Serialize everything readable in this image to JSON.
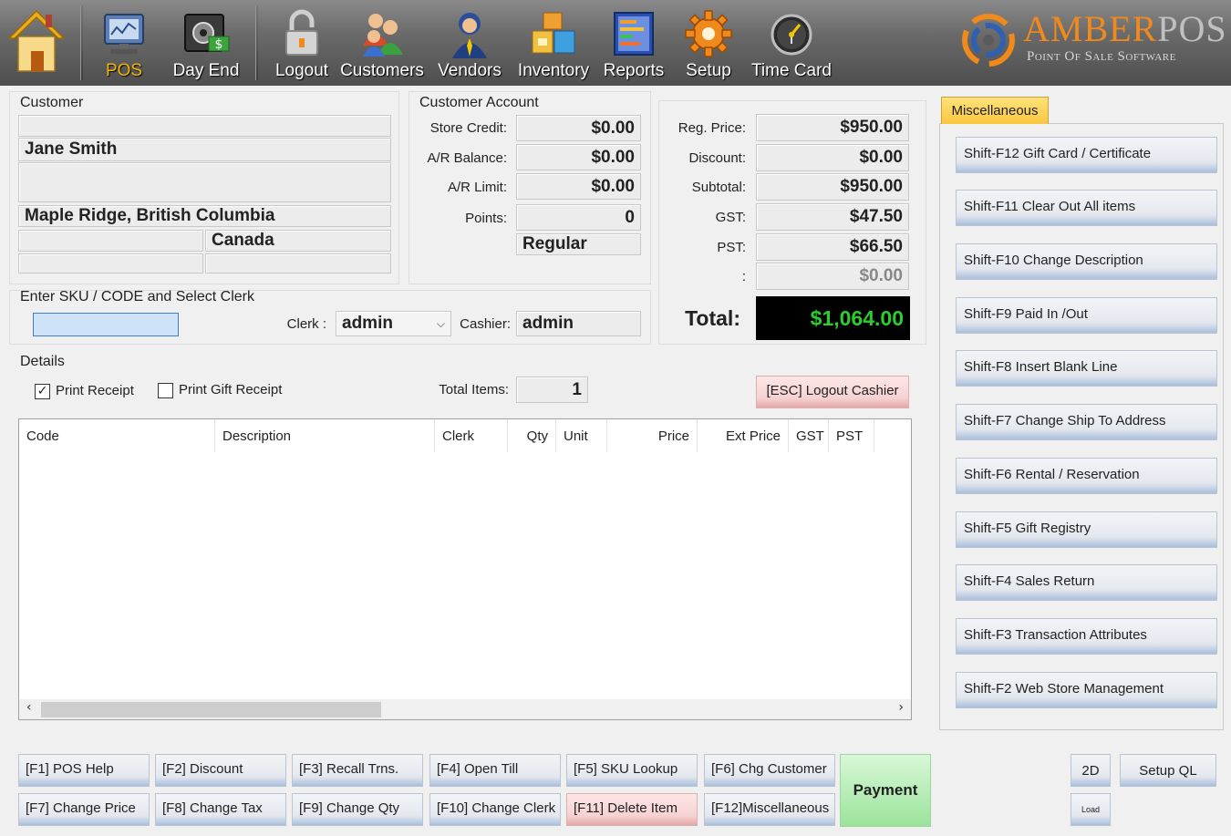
{
  "toolbar": {
    "items": [
      {
        "label": "",
        "icon": "home-icon"
      },
      {
        "label": "POS",
        "icon": "pos-terminal-icon",
        "active": true
      },
      {
        "label": "Day End",
        "icon": "safe-money-icon"
      },
      {
        "label": "Logout",
        "icon": "padlock-icon"
      },
      {
        "label": "Customers",
        "icon": "customers-icon"
      },
      {
        "label": "Vendors",
        "icon": "vendor-icon"
      },
      {
        "label": "Inventory",
        "icon": "inventory-boxes-icon"
      },
      {
        "label": "Reports",
        "icon": "reports-icon"
      },
      {
        "label": "Setup",
        "icon": "gear-icon"
      },
      {
        "label": "Time Card",
        "icon": "clock-icon"
      }
    ],
    "logo": {
      "name_a": "AMBER",
      "name_b": "POS",
      "subtitle": "Point Of Sale Software"
    }
  },
  "customer": {
    "title": "Customer",
    "line1": "",
    "name": "Jane Smith",
    "line3": "",
    "city": "Maple Ridge, British Columbia",
    "postal": "",
    "country": "Canada",
    "phone": "",
    "extra": ""
  },
  "account": {
    "title": "Customer Account",
    "store_credit_label": "Store Credit:",
    "store_credit": "$0.00",
    "ar_balance_label": "A/R Balance:",
    "ar_balance": "$0.00",
    "ar_limit_label": "A/R Limit:",
    "ar_limit": "$0.00",
    "points_label": "Points:",
    "points": "0",
    "price_level": "Regular"
  },
  "totals": {
    "reg_price_label": "Reg. Price:",
    "reg_price": "$950.00",
    "discount_label": "Discount:",
    "discount": "$0.00",
    "subtotal_label": "Subtotal:",
    "subtotal": "$950.00",
    "gst_label": "GST:",
    "gst": "$47.50",
    "pst_label": "PST:",
    "pst": "$66.50",
    "other_label": ":",
    "other": "$0.00",
    "total_label": "Total:",
    "total": "$1,064.00",
    "total_color": "#2ecc2e"
  },
  "entry": {
    "title": "Enter SKU / CODE and Select Clerk",
    "sku_value": "",
    "clerk_label": "Clerk :",
    "clerk": "admin",
    "cashier_label": "Cashier:",
    "cashier": "admin"
  },
  "details": {
    "title": "Details",
    "print_receipt": "Print Receipt",
    "print_receipt_checked": "✓",
    "print_gift": "Print Gift Receipt",
    "total_items_label": "Total Items:",
    "total_items": "1",
    "logout_cashier": "[ESC] Logout Cashier"
  },
  "grid": {
    "columns": [
      "Code",
      "Description",
      "Clerk",
      "Qty",
      "Unit",
      "Price",
      "Ext Price",
      "GST",
      "PST"
    ]
  },
  "misc": {
    "tab": "Miscellaneous",
    "buttons": [
      "Shift-F12  Gift Card / Certificate",
      "Shift-F11 Clear Out All items",
      "Shift-F10  Change Description",
      "Shift-F9   Paid In /Out",
      "Shift-F8  Insert Blank Line",
      "Shift-F7  Change Ship To Address",
      "Shift-F6 Rental / Reservation",
      "Shift-F5  Gift Registry",
      "Shift-F4  Sales Return",
      "Shift-F3  Transaction Attributes",
      "Shift-F2 Web Store Management"
    ]
  },
  "fkeys": {
    "row1": [
      "[F1] POS Help",
      "[F2] Discount",
      "[F3] Recall Trns.",
      "[F4] Open Till",
      "[F5] SKU Lookup",
      "[F6] Chg Customer"
    ],
    "row2": [
      "[F7] Change Price",
      "[F8] Change Tax",
      "[F9] Change Qty",
      "[F10] Change Clerk",
      "[F11] Delete Item",
      "[F12]Miscellaneous"
    ],
    "payment": "Payment",
    "btn_2d": "2D",
    "setup_ql": "Setup QL",
    "load": "Load"
  }
}
